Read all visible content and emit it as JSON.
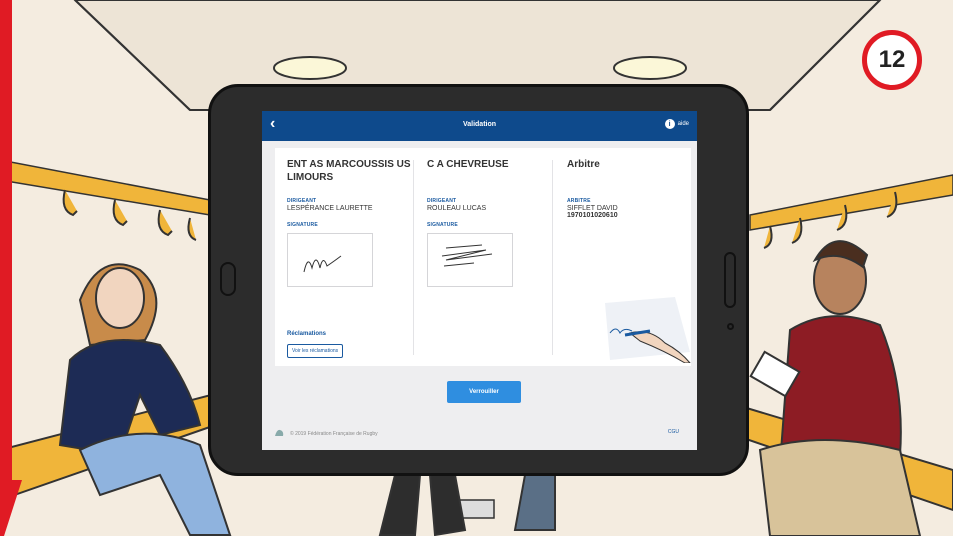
{
  "step_badge": "12",
  "app": {
    "title": "Validation",
    "help_label": "aide",
    "help_glyph": "i",
    "back_glyph": "‹"
  },
  "teams": [
    {
      "club": "ENT AS MARCOUSSIS US LIMOURS",
      "role_label": "DIRIGEANT",
      "person": "LESPÉRANCE LAURETTE",
      "signature_label": "SIGNATURE"
    },
    {
      "club": "C A CHEVREUSE",
      "role_label": "DIRIGEANT",
      "person": "ROULEAU LUCAS",
      "signature_label": "SIGNATURE"
    }
  ],
  "referee": {
    "heading": "Arbitre",
    "role_label": "ARBITRE",
    "person": "SIFFLET DAVID",
    "license": "1970101020610"
  },
  "complaints": {
    "title": "Réclamations",
    "button": "Voir les réclamations"
  },
  "lock_button": "Verrouiller",
  "footer": {
    "copyright": "© 2019 Fédération Française de Rugby",
    "cgu": "CGU"
  },
  "colors": {
    "header": "#0e4a8c",
    "accent": "#1a5aa0",
    "button": "#2f8ee0",
    "badge_ring": "#e01b24"
  }
}
